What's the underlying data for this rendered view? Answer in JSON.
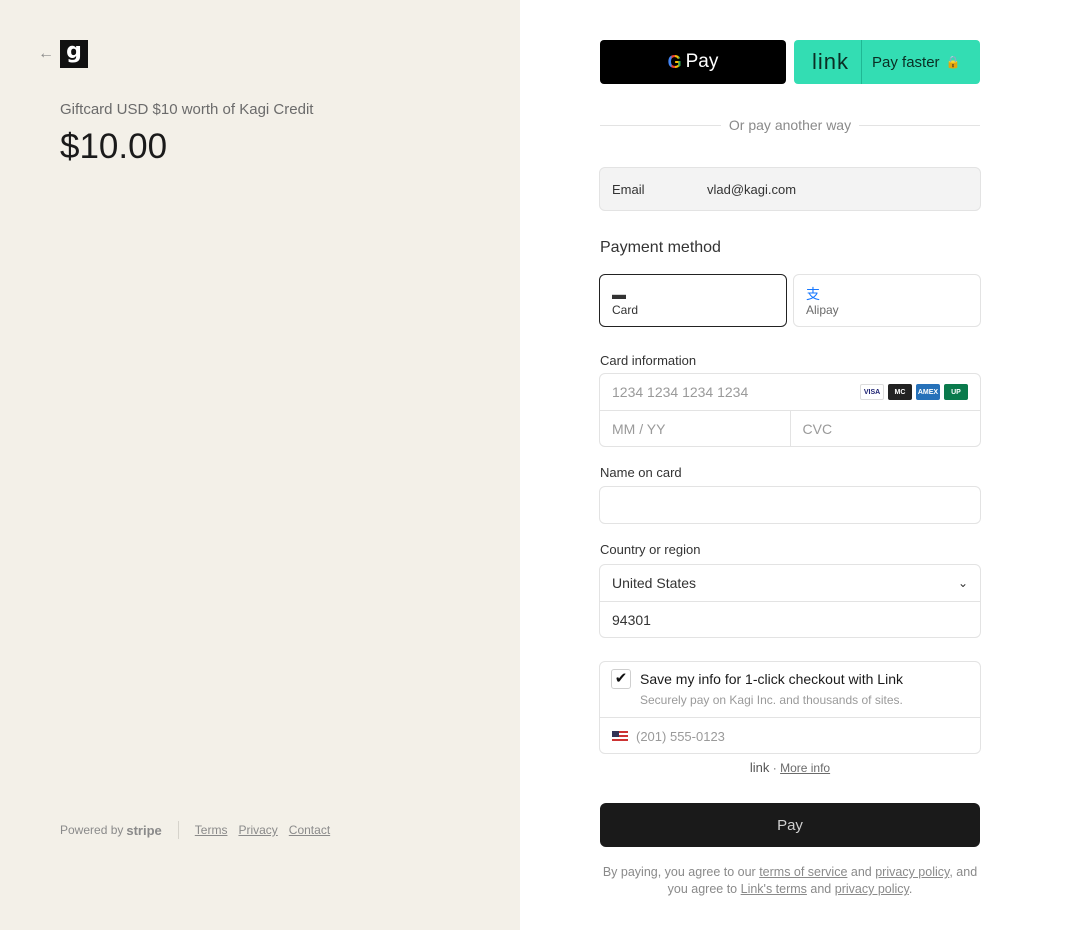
{
  "merchant": {
    "logo_letter": "g",
    "product_name": "Giftcard USD $10 worth of Kagi Credit",
    "price": "$10.00"
  },
  "footer": {
    "powered_by": "Powered by",
    "stripe": "stripe",
    "links": [
      "Terms",
      "Privacy",
      "Contact"
    ]
  },
  "express": {
    "gpay_label": "Pay",
    "link_logo": "link",
    "link_label": "Pay faster"
  },
  "divider_text": "Or pay another way",
  "email": {
    "label": "Email",
    "value": "vlad@kagi.com"
  },
  "payment_method": {
    "title": "Payment method",
    "options": [
      "Card",
      "Alipay"
    ],
    "selected": "Card"
  },
  "card_info": {
    "label": "Card information",
    "number_placeholder": "1234 1234 1234 1234",
    "expiry_placeholder": "MM / YY",
    "cvc_placeholder": "CVC",
    "brands": [
      "VISA",
      "MC",
      "AMEX",
      "UP"
    ]
  },
  "name_on_card": {
    "label": "Name on card",
    "value": ""
  },
  "country": {
    "label": "Country or region",
    "value": "United States",
    "zip": "94301"
  },
  "save_info": {
    "checked": true,
    "title": "Save my info for 1-click checkout with Link",
    "subtitle": "Securely pay on Kagi Inc. and thousands of sites.",
    "phone_placeholder": "(201) 555-0123"
  },
  "link_info": {
    "logo": "link",
    "more": "More info"
  },
  "pay_button": "Pay",
  "terms": {
    "p1": "By paying, you agree to our",
    "tos": "terms of service",
    "and1": "and",
    "privacy1": "privacy policy",
    "p2": ", and you agree to",
    "link_terms": "Link's terms",
    "and2": "and",
    "privacy2": "privacy policy",
    "end": "."
  },
  "colors": {
    "link_green": "#33ddb3",
    "left_bg": "#f3f0e8",
    "pay_bg": "#1a1a1a"
  }
}
